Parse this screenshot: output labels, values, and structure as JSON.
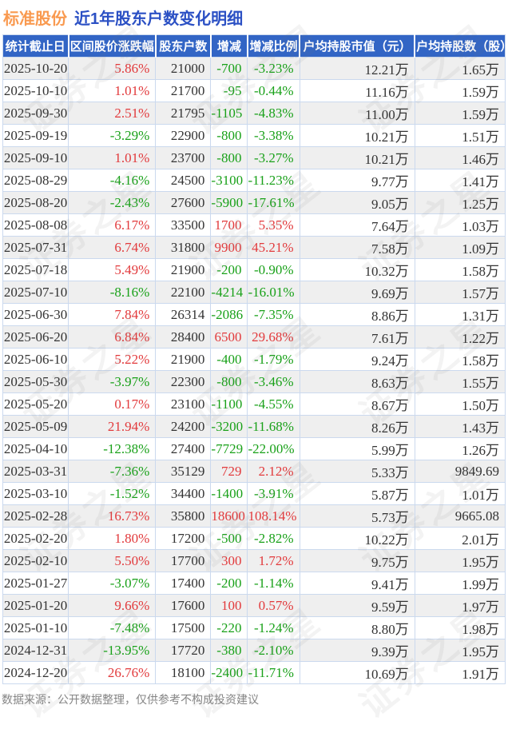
{
  "header": {
    "stock_name": "标准股份",
    "report_title": "近1年股东户数变化明细"
  },
  "watermark": {
    "text": "证券之星"
  },
  "footer": {
    "note": "数据来源：公开数据整理，仅供参考不构成投资建议"
  },
  "colors": {
    "header_bg": "#3265c5",
    "title_orange": "#f99a50",
    "title_blue": "#2b50c4",
    "up_red": "#e23a3c",
    "down_green": "#19a119",
    "row_alt_bg": "#efefef",
    "grid_line": "#cbd9ee",
    "text_dark": "#333333",
    "footer_gray": "#858585"
  },
  "chart_data": {
    "type": "table",
    "title": "标准股份 近1年股东户数变化明细",
    "columns": [
      "统计截止日",
      "区间股价涨跌幅",
      "股东户数",
      "增减",
      "增减比例",
      "户均持股市值（元）",
      "户均持股数（股）"
    ],
    "signed_column_indexes": [
      1,
      3,
      4
    ],
    "sign_color_rule": "positive=red(up), negative=green(down)",
    "rows": [
      [
        "2025-10-20",
        "5.86%",
        "21000",
        "-700",
        "-3.23%",
        "12.21万",
        "1.65万"
      ],
      [
        "2025-10-10",
        "1.01%",
        "21700",
        "-95",
        "-0.44%",
        "11.16万",
        "1.59万"
      ],
      [
        "2025-09-30",
        "2.51%",
        "21795",
        "-1105",
        "-4.83%",
        "11.00万",
        "1.59万"
      ],
      [
        "2025-09-19",
        "-3.29%",
        "22900",
        "-800",
        "-3.38%",
        "10.21万",
        "1.51万"
      ],
      [
        "2025-09-10",
        "1.01%",
        "23700",
        "-800",
        "-3.27%",
        "10.21万",
        "1.46万"
      ],
      [
        "2025-08-29",
        "-4.16%",
        "24500",
        "-3100",
        "-11.23%",
        "9.77万",
        "1.41万"
      ],
      [
        "2025-08-20",
        "-2.43%",
        "27600",
        "-5900",
        "-17.61%",
        "9.05万",
        "1.25万"
      ],
      [
        "2025-08-08",
        "6.17%",
        "33500",
        "1700",
        "5.35%",
        "7.64万",
        "1.03万"
      ],
      [
        "2025-07-31",
        "6.74%",
        "31800",
        "9900",
        "45.21%",
        "7.58万",
        "1.09万"
      ],
      [
        "2025-07-18",
        "5.49%",
        "21900",
        "-200",
        "-0.90%",
        "10.32万",
        "1.58万"
      ],
      [
        "2025-07-10",
        "-8.16%",
        "22100",
        "-4214",
        "-16.01%",
        "9.69万",
        "1.57万"
      ],
      [
        "2025-06-30",
        "7.84%",
        "26314",
        "-2086",
        "-7.35%",
        "8.86万",
        "1.31万"
      ],
      [
        "2025-06-20",
        "6.84%",
        "28400",
        "6500",
        "29.68%",
        "7.61万",
        "1.22万"
      ],
      [
        "2025-06-10",
        "5.22%",
        "21900",
        "-400",
        "-1.79%",
        "9.24万",
        "1.58万"
      ],
      [
        "2025-05-30",
        "-3.97%",
        "22300",
        "-800",
        "-3.46%",
        "8.63万",
        "1.55万"
      ],
      [
        "2025-05-20",
        "0.17%",
        "23100",
        "-1100",
        "-4.55%",
        "8.67万",
        "1.50万"
      ],
      [
        "2025-05-09",
        "21.94%",
        "24200",
        "-3200",
        "-11.68%",
        "8.26万",
        "1.43万"
      ],
      [
        "2025-04-10",
        "-12.38%",
        "27400",
        "-7729",
        "-22.00%",
        "5.99万",
        "1.26万"
      ],
      [
        "2025-03-31",
        "-7.36%",
        "35129",
        "729",
        "2.12%",
        "5.33万",
        "9849.69"
      ],
      [
        "2025-03-10",
        "-1.52%",
        "34400",
        "-1400",
        "-3.91%",
        "5.87万",
        "1.01万"
      ],
      [
        "2025-02-28",
        "16.73%",
        "35800",
        "18600",
        "108.14%",
        "5.73万",
        "9665.08"
      ],
      [
        "2025-02-20",
        "1.80%",
        "17200",
        "-500",
        "-2.82%",
        "10.22万",
        "2.01万"
      ],
      [
        "2025-02-10",
        "5.50%",
        "17700",
        "300",
        "1.72%",
        "9.75万",
        "1.95万"
      ],
      [
        "2025-01-27",
        "-3.07%",
        "17400",
        "-200",
        "-1.14%",
        "9.41万",
        "1.99万"
      ],
      [
        "2025-01-20",
        "9.66%",
        "17600",
        "100",
        "0.57%",
        "9.59万",
        "1.97万"
      ],
      [
        "2025-01-10",
        "-7.48%",
        "17500",
        "-220",
        "-1.24%",
        "8.80万",
        "1.98万"
      ],
      [
        "2024-12-31",
        "-13.95%",
        "17720",
        "-380",
        "-2.10%",
        "9.39万",
        "1.95万"
      ],
      [
        "2024-12-20",
        "26.76%",
        "18100",
        "-2400",
        "-11.71%",
        "10.69万",
        "1.91万"
      ]
    ]
  }
}
